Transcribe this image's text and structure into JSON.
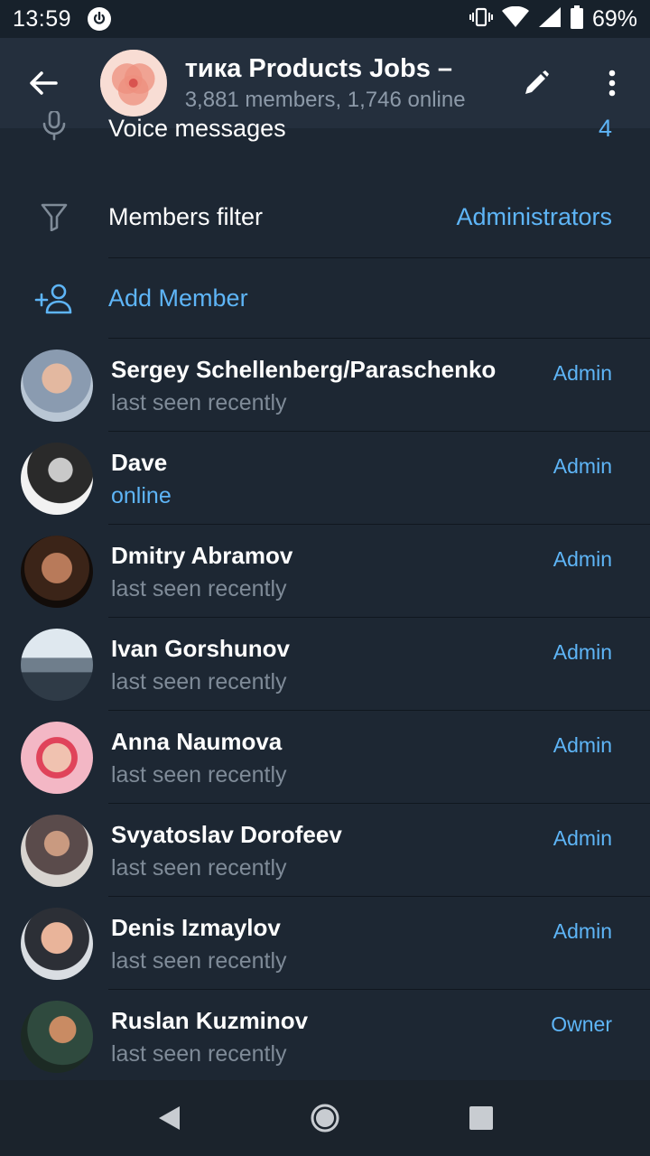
{
  "status_bar": {
    "time": "13:59",
    "battery": "69%"
  },
  "header": {
    "title": "тика   Products Jobs –",
    "subtitle": "3,881 members, 1,746 online"
  },
  "settings": {
    "voice_label": "Voice messages",
    "voice_value": "4",
    "filter_label": "Members filter",
    "filter_value": "Administrators",
    "add_member_label": "Add Member"
  },
  "members": [
    {
      "name": "Sergey Schellenberg/Paraschenko",
      "status": "last seen recently",
      "role": "Admin"
    },
    {
      "name": "Dave",
      "status": "online",
      "role": "Admin"
    },
    {
      "name": "Dmitry Abramov",
      "status": "last seen recently",
      "role": "Admin"
    },
    {
      "name": "Ivan Gorshunov",
      "status": "last seen recently",
      "role": "Admin"
    },
    {
      "name": "Anna Naumova",
      "status": "last seen recently",
      "role": "Admin"
    },
    {
      "name": "Svyatoslav Dorofeev",
      "status": "last seen recently",
      "role": "Admin"
    },
    {
      "name": "Denis Izmaylov",
      "status": "last seen recently",
      "role": "Admin"
    },
    {
      "name": "Ruslan Kuzminov",
      "status": "last seen recently",
      "role": "Owner"
    }
  ],
  "colors": {
    "background": "#1d2733",
    "header": "#242f3d",
    "accent": "#5eb5f7",
    "secondary_text": "#7f8b98"
  },
  "icons": [
    "back-arrow-icon",
    "edit-pencil-icon",
    "more-vert-icon",
    "microphone-icon",
    "filter-funnel-icon",
    "add-person-icon",
    "nav-back-icon",
    "nav-home-icon",
    "nav-recents-icon"
  ]
}
